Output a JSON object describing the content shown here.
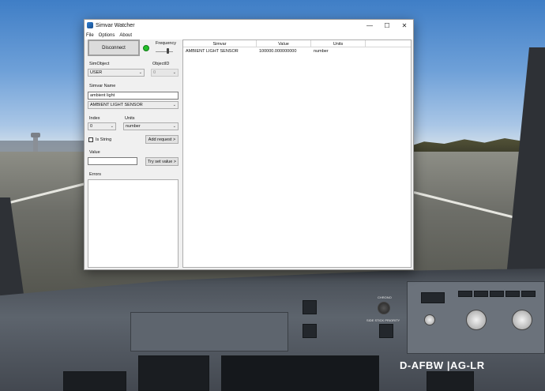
{
  "window": {
    "title": "Simvar Watcher",
    "minimize": "—",
    "maximize": "☐",
    "close": "✕"
  },
  "menu": {
    "items": [
      "File",
      "Options",
      "About"
    ]
  },
  "controls": {
    "connect_button": "Disconnect",
    "connection_status_color": "#23c02b",
    "frequency_label": "Frequency",
    "simobject_label": "SimObject",
    "simobject_value": "USER",
    "objectid_label": "ObjectID",
    "objectid_value": "0",
    "simvar_name_label": "Simvar Name",
    "simvar_search_value": "ambient light",
    "simvar_selected": "AMBIENT LIGHT SENSOR",
    "index_label": "Index",
    "index_value": "0",
    "units_label": "Units",
    "units_value": "number",
    "is_string_label": "Is String",
    "add_request_button": "Add request >",
    "value_label": "Value",
    "value_input": "",
    "try_set_button": "Try set value >",
    "errors_label": "Errors"
  },
  "table": {
    "columns": [
      "Simvar",
      "Value",
      "Units"
    ],
    "rows": [
      {
        "simvar": "AMBIENT LIGHT SENSOR",
        "value": "100000.000000000",
        "units": "number"
      }
    ]
  },
  "background": {
    "registration": "D-AFBW |AG-LR",
    "side_stick_label": "SIDE STICK PRIORITY",
    "chrono_label": "CHRONO"
  }
}
